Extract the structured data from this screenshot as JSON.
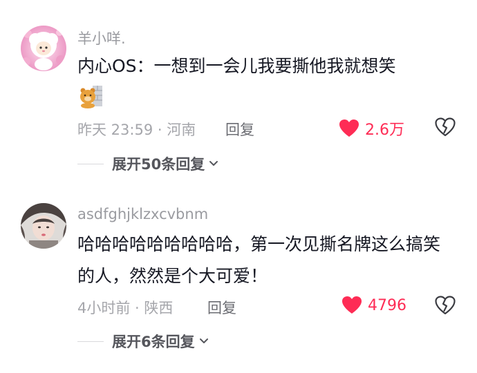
{
  "comments": [
    {
      "username": "羊小咩.",
      "text": "内心OS：一想到一会儿我要撕他我就想笑",
      "sticker_icon": "bear-emoji-icon",
      "time": "昨天 23:59",
      "location": "河南",
      "meta": "昨天 23:59 · 河南",
      "reply_label": "回复",
      "like_count": "2.6万",
      "expand_label": "展开50条回复"
    },
    {
      "username": "asdfghjklzxcvbnm",
      "text": "哈哈哈哈哈哈哈哈哈，第一次见撕名牌这么搞笑的人，然然是个大可爱！",
      "time": "4小时前",
      "location": "陕西",
      "meta": "4小时前 · 陕西",
      "reply_label": "回复",
      "like_count": "4796",
      "expand_label": "展开6条回复"
    }
  ],
  "icons": {
    "like": "heart-icon",
    "dislike": "broken-heart-icon",
    "expand": "chevron-down-icon"
  },
  "colors": {
    "like_red": "#fe2c55",
    "meta_gray": "#a5a6ab",
    "text_dark": "#161823"
  }
}
